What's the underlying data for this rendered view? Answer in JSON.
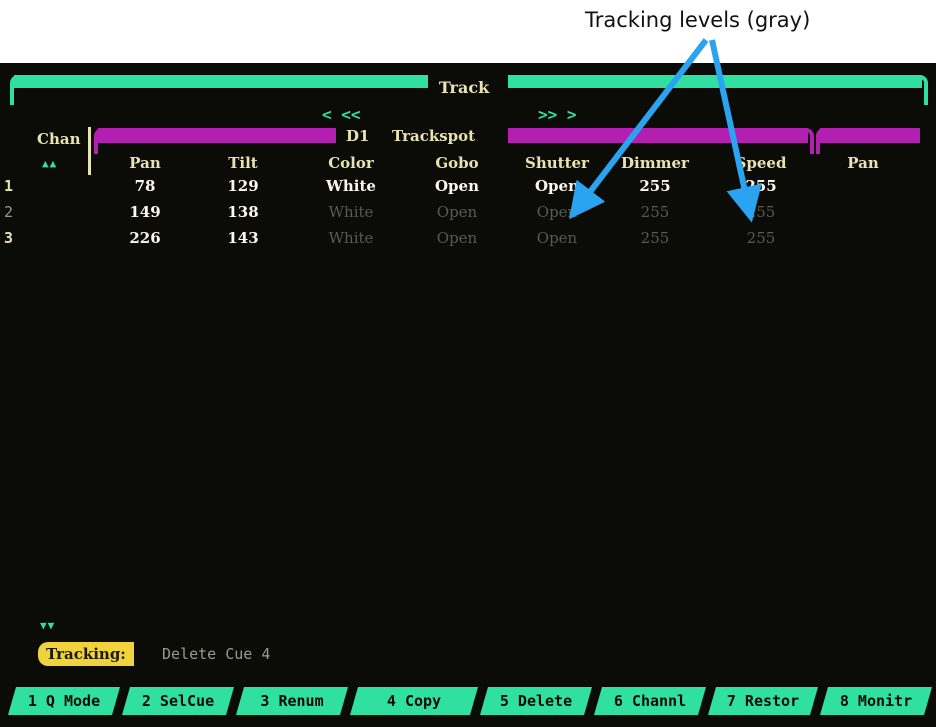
{
  "annotation": {
    "text": "Tracking levels (gray)",
    "arrow_color": "#2aa4f0"
  },
  "header": {
    "title": "Track",
    "nav_left": "< <<",
    "nav_right": ">> >"
  },
  "group": {
    "page": "D1",
    "fixture": "Trackspot"
  },
  "chan_label": "Chan",
  "scroll": {
    "up": "▲▲",
    "down": "▼▼"
  },
  "columns": [
    "Pan",
    "Tilt",
    "Color",
    "Gobo",
    "Shutter",
    "Dimmer",
    "Speed",
    "Pan"
  ],
  "rows": [
    {
      "chan": "1",
      "tracking": false,
      "values": [
        "78",
        "129",
        "White",
        "Open",
        "Open",
        "255",
        "255"
      ]
    },
    {
      "chan": "2",
      "tracking": true,
      "values": [
        "149",
        "138",
        "White",
        "Open",
        "Open",
        "255",
        "255"
      ]
    },
    {
      "chan": "3",
      "tracking": true,
      "values": [
        "226",
        "143",
        "White",
        "Open",
        "Open",
        "255",
        "255"
      ]
    }
  ],
  "status": {
    "badge": "Tracking:",
    "message": "Delete Cue 4"
  },
  "softkeys": [
    "1 Q Mode",
    "2 SelCue",
    "3 Renum",
    "4 Copy",
    "5 Delete",
    "6 Channl",
    "7 Restor",
    "8 Monitr"
  ],
  "colors": {
    "accent": "#30e0a0",
    "fixture_bar": "#b31fb0",
    "badge": "#f0d23a",
    "tracking_text": "#5a5a52",
    "text": "#e8e4b0"
  }
}
